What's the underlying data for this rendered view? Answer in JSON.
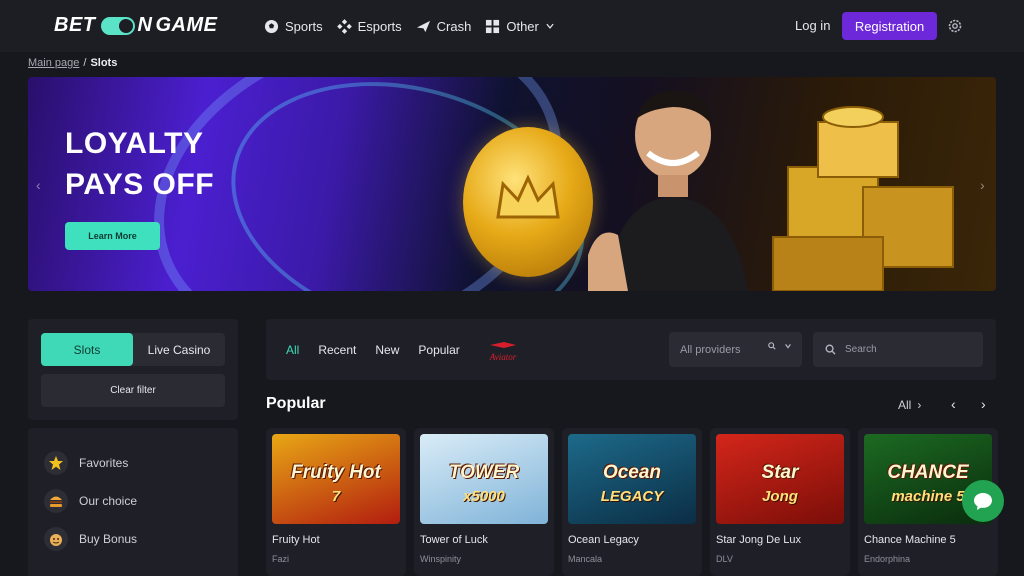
{
  "header": {
    "logo": {
      "left": "BET",
      "mid": "N",
      "right": "GAME"
    },
    "nav": [
      {
        "label": "Sports",
        "icon": "soccer-ball-icon"
      },
      {
        "label": "Esports",
        "icon": "gamepad-icon"
      },
      {
        "label": "Crash",
        "icon": "plane-icon"
      },
      {
        "label": "Other",
        "icon": "grid-icon"
      }
    ],
    "login_label": "Log in",
    "register_label": "Registration"
  },
  "breadcrumb": {
    "home": "Main page",
    "separator": "/",
    "current": "Slots"
  },
  "banner": {
    "title_line1": "LOYALTY",
    "title_line2": "PAYS OFF",
    "cta_label": "Learn More"
  },
  "sidebar": {
    "segment": {
      "left": "Slots",
      "right": "Live Casino"
    },
    "clear_filter_label": "Clear filter",
    "categories": [
      {
        "label": "Favorites",
        "icon": "star-icon"
      },
      {
        "label": "Our choice",
        "icon": "burger-icon"
      },
      {
        "label": "Buy Bonus",
        "icon": "bonus-icon"
      }
    ]
  },
  "filters": {
    "tabs": [
      "All",
      "Recent",
      "New",
      "Popular"
    ],
    "aviator_label": "Aviator",
    "providers_placeholder": "All providers",
    "search_placeholder": "Search"
  },
  "popular": {
    "title": "Popular",
    "see_all_label": "All",
    "games": [
      {
        "name": "Fruity Hot",
        "provider": "Fazi",
        "thumb_title": "Fruity Hot",
        "thumb_sub": "7",
        "bg1": "#e8a715",
        "bg2": "#b21d0f"
      },
      {
        "name": "Tower of Luck",
        "provider": "Winspinity",
        "thumb_title": "TOWER",
        "thumb_sub": "x5000",
        "bg1": "#d9ecf7",
        "bg2": "#7fb3d8"
      },
      {
        "name": "Ocean Legacy",
        "provider": "Mancala",
        "thumb_title": "Ocean",
        "thumb_sub": "LEGACY",
        "bg1": "#1d6a8a",
        "bg2": "#0b2e45"
      },
      {
        "name": "Star Jong De Lux",
        "provider": "DLV",
        "thumb_title": "Star",
        "thumb_sub": "Jong",
        "bg1": "#d4261a",
        "bg2": "#7a0e08"
      },
      {
        "name": "Chance Machine 5",
        "provider": "Endorphina",
        "thumb_title": "CHANCE",
        "thumb_sub": "machine 5",
        "bg1": "#1c6a22",
        "bg2": "#0a2c0d"
      }
    ]
  }
}
